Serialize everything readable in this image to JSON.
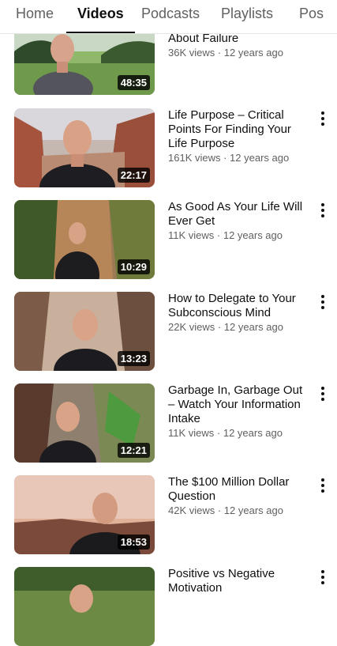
{
  "tabs": [
    "Home",
    "Videos",
    "Podcasts",
    "Playlists",
    "Pos"
  ],
  "active_tab": "Videos",
  "videos": [
    {
      "title": "About Failure",
      "meta": "36K views · 12 years ago",
      "duration": "48:35",
      "scene": "park"
    },
    {
      "title": "Life Purpose – Critical Points For Finding Your Life Purpose",
      "meta": "161K views · 12 years ago",
      "duration": "22:17",
      "scene": "canyon"
    },
    {
      "title": "As Good As Your Life Will Ever Get",
      "meta": "11K views · 12 years ago",
      "duration": "10:29",
      "scene": "forest"
    },
    {
      "title": "How to Delegate to Your Subconscious Mind",
      "meta": "22K views · 12 years ago",
      "duration": "13:23",
      "scene": "slot"
    },
    {
      "title": "Garbage In, Garbage Out – Watch Your Information Intake",
      "meta": "11K views · 12 years ago",
      "duration": "12:21",
      "scene": "green"
    },
    {
      "title": "The $100 Million Dollar Question",
      "meta": "42K views · 12 years ago",
      "duration": "18:53",
      "scene": "sunset"
    },
    {
      "title": "Positive vs Negative Motivation",
      "meta": "",
      "duration": "",
      "scene": "forest"
    }
  ]
}
